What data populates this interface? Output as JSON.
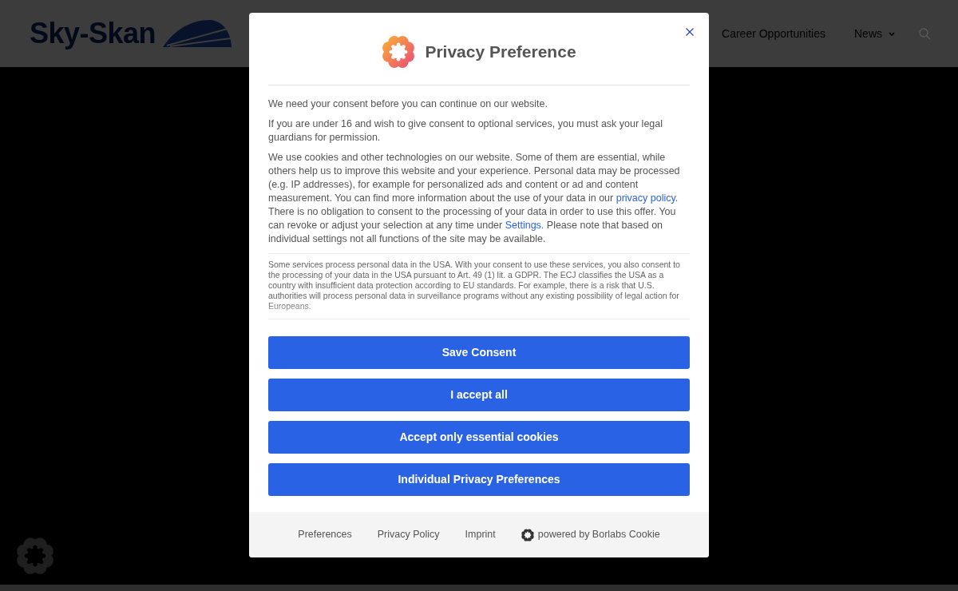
{
  "header": {
    "logo": {
      "text": "Sky-Skan"
    },
    "nav": [
      {
        "label": "Career Opportunities",
        "has_menu": false
      },
      {
        "label": "News",
        "has_menu": true
      }
    ]
  },
  "dialog": {
    "title": "Privacy Preference",
    "paragraphs": [
      {
        "segments": [
          {
            "kind": "text",
            "text": "We need your consent before you can continue on our website."
          }
        ]
      },
      {
        "segments": [
          {
            "kind": "text",
            "text": "If you are under 16 and wish to give consent to optional services, you must ask your legal guardians for permission."
          }
        ]
      },
      {
        "segments": [
          {
            "kind": "text",
            "text": "We use cookies and other technologies on our website. Some of them are essential, while others help us to improve this website and your experience. Personal data may be processed (e.g. IP addresses), for example for personalized ads and content or ad and content measurement. You can find more information about the use of your data in our "
          },
          {
            "kind": "link",
            "text": "privacy policy"
          },
          {
            "kind": "text",
            "text": ". There is no obligation to consent to the processing of your data in order to use this offer. You can revoke or adjust your selection at any time under "
          },
          {
            "kind": "link",
            "text": "Settings"
          },
          {
            "kind": "text",
            "text": ". Please note that based on individual settings not all functions of the site may be available."
          }
        ]
      }
    ],
    "notice": "Some services process personal data in the USA. With your consent to use these services, you also consent to the processing of your data in the USA pursuant to Art. 49 (1) lit. a GDPR. The ECJ classifies the USA as a country with insufficient data protection according to EU standards. For example, there is a risk that U.S. authorities will process personal data in surveillance programs without any existing possibility of legal action for Europeans.",
    "buttons": [
      "Save Consent",
      "I accept all",
      "Accept only essential cookies",
      "Individual Privacy Preferences"
    ],
    "footer_links": [
      {
        "kind": "link",
        "label": "Preferences"
      },
      {
        "kind": "link",
        "label": "Privacy Policy"
      },
      {
        "kind": "link",
        "label": "Imprint"
      },
      {
        "kind": "brand",
        "label": "powered by Borlabs Cookie"
      }
    ]
  }
}
